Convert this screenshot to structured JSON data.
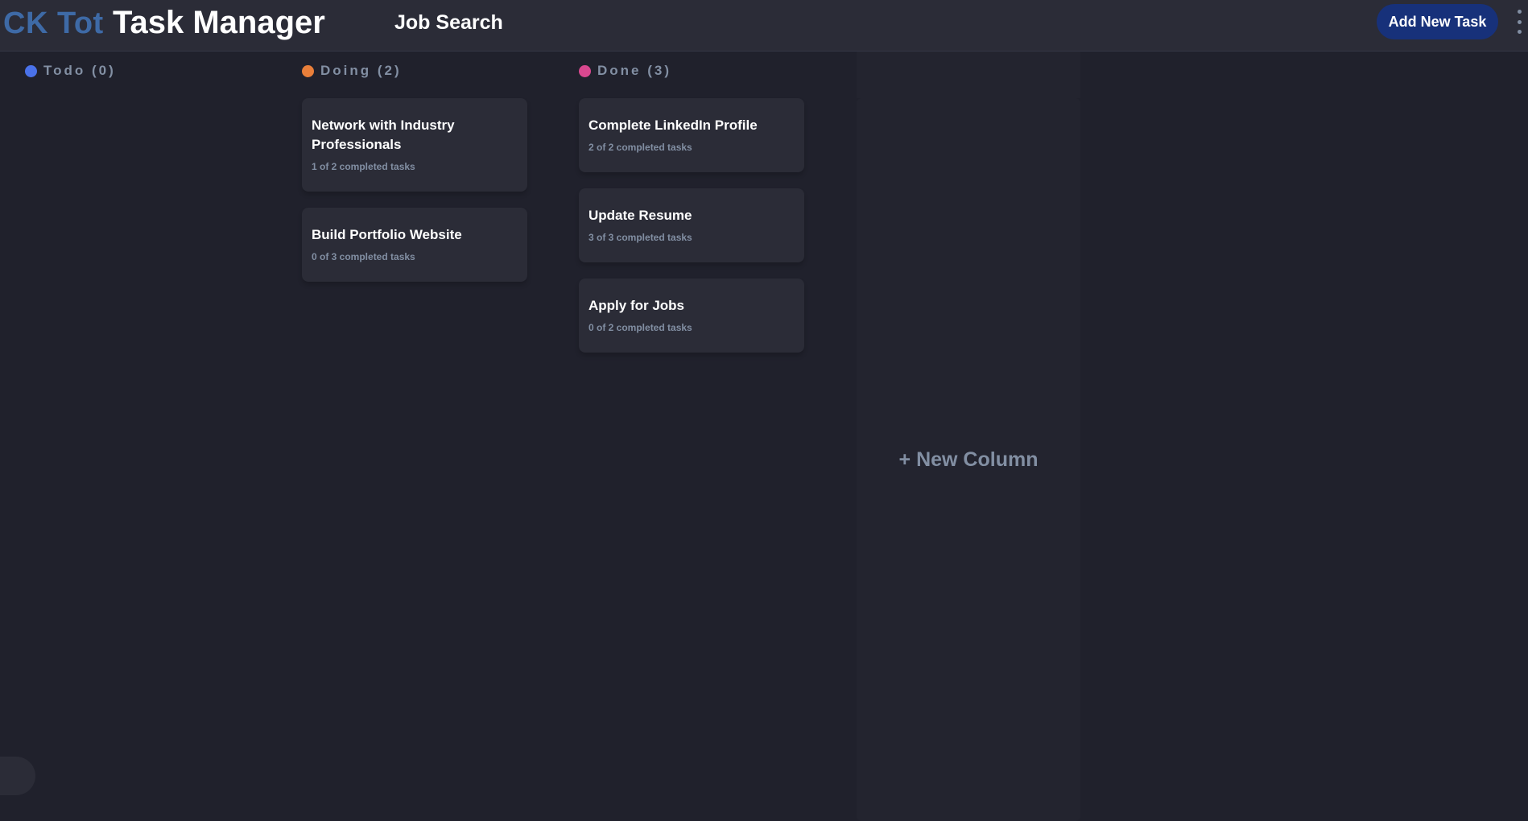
{
  "header": {
    "logo": "CK Tot",
    "app_title": "Task Manager",
    "board_title": "Job Search",
    "add_task_label": "Add New Task"
  },
  "colors": {
    "todo": "#4a72ea",
    "doing": "#e97f3a",
    "done": "#d9488f",
    "accent": "#17317a"
  },
  "columns": [
    {
      "label": "Todo (0)",
      "cards": []
    },
    {
      "label": "Doing (2)",
      "cards": [
        {
          "title": "Network with Industry Professionals",
          "subtitle": "1 of 2 completed tasks"
        },
        {
          "title": "Build Portfolio Website",
          "subtitle": "0 of 3 completed tasks"
        }
      ]
    },
    {
      "label": "Done (3)",
      "cards": [
        {
          "title": "Complete LinkedIn Profile",
          "subtitle": "2 of 2 completed tasks"
        },
        {
          "title": "Update Resume",
          "subtitle": "3 of 3 completed tasks"
        },
        {
          "title": "Apply for Jobs",
          "subtitle": "0 of 2 completed tasks"
        }
      ]
    }
  ],
  "new_column_label": "+ New Column"
}
